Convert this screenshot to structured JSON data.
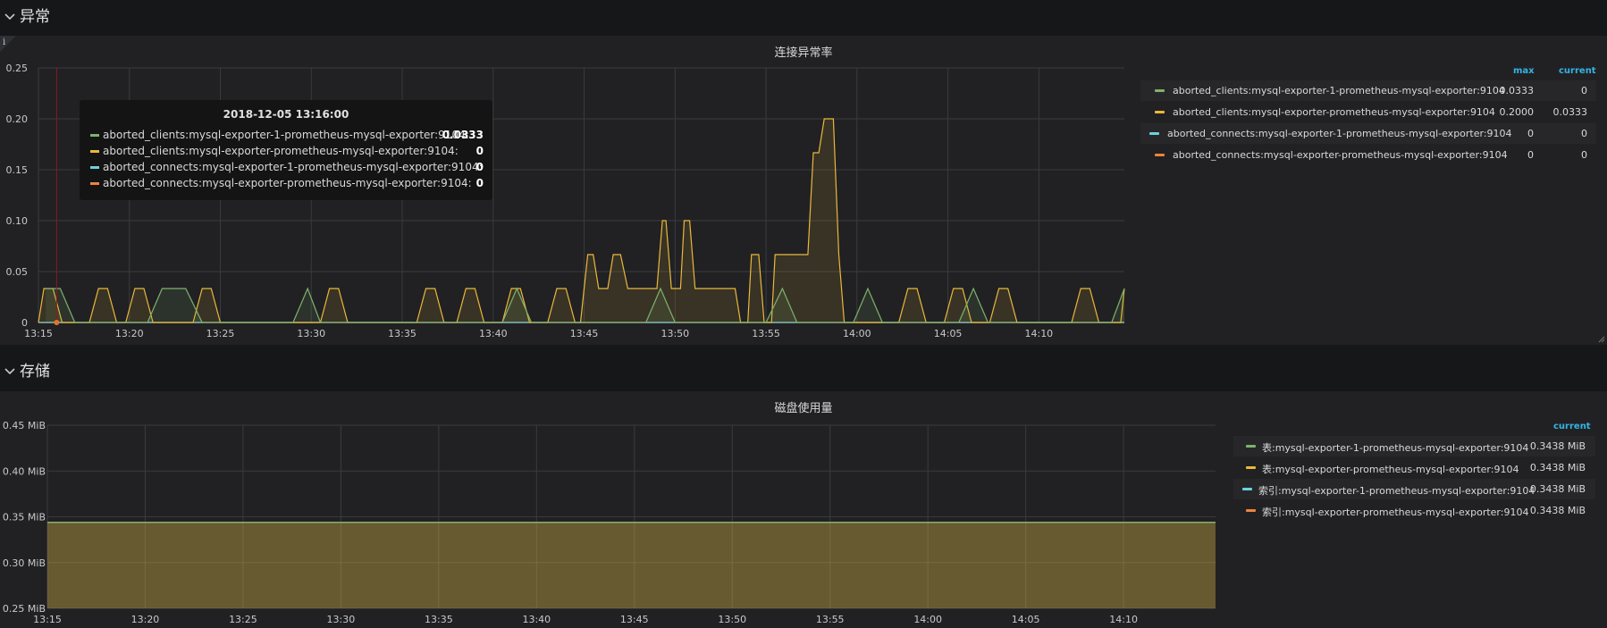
{
  "rows": [
    {
      "title": "异常"
    },
    {
      "title": "存储"
    }
  ],
  "anomaly_panel": {
    "title": "连接异常率",
    "legend_headers": {
      "max": "max",
      "current": "current"
    },
    "legend": [
      {
        "name": "aborted_clients:mysql-exporter-1-prometheus-mysql-exporter:9104",
        "max": "0.0333",
        "current": "0",
        "color": "#7eb26d"
      },
      {
        "name": "aborted_clients:mysql-exporter-prometheus-mysql-exporter:9104",
        "max": "0.2000",
        "current": "0.0333",
        "color": "#eab839"
      },
      {
        "name": "aborted_connects:mysql-exporter-1-prometheus-mysql-exporter:9104",
        "max": "0",
        "current": "0",
        "color": "#6ed0e0"
      },
      {
        "name": "aborted_connects:mysql-exporter-prometheus-mysql-exporter:9104",
        "max": "0",
        "current": "0",
        "color": "#ef843c"
      }
    ],
    "tooltip": {
      "time": "2018-12-05 13:16:00",
      "rows": [
        {
          "name": "aborted_clients:mysql-exporter-1-prometheus-mysql-exporter:9104:",
          "value": "0.0333",
          "color": "#7eb26d"
        },
        {
          "name": "aborted_clients:mysql-exporter-prometheus-mysql-exporter:9104:",
          "value": "0",
          "color": "#eab839"
        },
        {
          "name": "aborted_connects:mysql-exporter-1-prometheus-mysql-exporter:9104:",
          "value": "0",
          "color": "#6ed0e0"
        },
        {
          "name": "aborted_connects:mysql-exporter-prometheus-mysql-exporter:9104:",
          "value": "0",
          "color": "#ef843c"
        }
      ]
    }
  },
  "storage_panel": {
    "title": "磁盘使用量",
    "legend_headers": {
      "current": "current"
    },
    "legend": [
      {
        "name": "表:mysql-exporter-1-prometheus-mysql-exporter:9104",
        "current": "0.3438 MiB",
        "color": "#7eb26d"
      },
      {
        "name": "表:mysql-exporter-prometheus-mysql-exporter:9104",
        "current": "0.3438 MiB",
        "color": "#eab839"
      },
      {
        "name": "索引:mysql-exporter-1-prometheus-mysql-exporter:9104",
        "current": "0.3438 MiB",
        "color": "#6ed0e0"
      },
      {
        "name": "索引:mysql-exporter-prometheus-mysql-exporter:9104",
        "current": "0.3438 MiB",
        "color": "#ef843c"
      }
    ]
  },
  "chart_data": [
    {
      "type": "area",
      "title": "连接异常率",
      "x_tick_labels": [
        "13:15",
        "13:20",
        "13:25",
        "13:30",
        "13:35",
        "13:40",
        "13:45",
        "13:50",
        "13:55",
        "14:00",
        "14:05",
        "14:10"
      ],
      "x_range_minutes": [
        0,
        59.7
      ],
      "y_tick_labels": [
        "0",
        "0.05",
        "0.10",
        "0.15",
        "0.20",
        "0.25"
      ],
      "ylim": [
        0,
        0.25
      ],
      "grid": true,
      "legend_position": "right",
      "marker_time_minutes": 1,
      "series": [
        {
          "name": "aborted_clients:mysql-exporter-1-prometheus-mysql-exporter:9104",
          "color": "#7eb26d",
          "points": [
            [
              0.4,
              0.0333
            ],
            [
              1.2,
              0.0333
            ],
            [
              2,
              0
            ],
            [
              6,
              0
            ],
            [
              6.8,
              0.0333
            ],
            [
              8.1,
              0.0333
            ],
            [
              9,
              0
            ],
            [
              14,
              0
            ],
            [
              14.8,
              0.0333
            ],
            [
              15.5,
              0
            ],
            [
              25.5,
              0
            ],
            [
              26.3,
              0.0333
            ],
            [
              27.1,
              0
            ],
            [
              33.4,
              0
            ],
            [
              34.2,
              0.0333
            ],
            [
              35,
              0
            ],
            [
              40,
              0
            ],
            [
              40.9,
              0.0333
            ],
            [
              41.7,
              0
            ],
            [
              44.8,
              0
            ],
            [
              45.6,
              0.0333
            ],
            [
              46.4,
              0
            ],
            [
              50.6,
              0
            ],
            [
              51.4,
              0.0333
            ],
            [
              52.2,
              0
            ],
            [
              59,
              0
            ],
            [
              59.8,
              0.0333
            ],
            [
              60,
              0.0333
            ]
          ]
        },
        {
          "name": "aborted_clients:mysql-exporter-prometheus-mysql-exporter:9104",
          "color": "#eab839",
          "points": [
            [
              0,
              0
            ],
            [
              0.3,
              0.0333
            ],
            [
              0.8,
              0.0333
            ],
            [
              1.3,
              0
            ],
            [
              2.8,
              0
            ],
            [
              3.3,
              0.0333
            ],
            [
              3.8,
              0.0333
            ],
            [
              4.3,
              0
            ],
            [
              4.8,
              0
            ],
            [
              5.3,
              0.0333
            ],
            [
              5.8,
              0.0333
            ],
            [
              6.3,
              0
            ],
            [
              8.5,
              0
            ],
            [
              9,
              0.0333
            ],
            [
              9.5,
              0.0333
            ],
            [
              10,
              0
            ],
            [
              15.5,
              0
            ],
            [
              16,
              0.0333
            ],
            [
              16.5,
              0.0333
            ],
            [
              17,
              0
            ],
            [
              20.8,
              0
            ],
            [
              21.3,
              0.0333
            ],
            [
              21.8,
              0.0333
            ],
            [
              22.3,
              0
            ],
            [
              23,
              0
            ],
            [
              23.5,
              0.0333
            ],
            [
              24,
              0.0333
            ],
            [
              24.5,
              0
            ],
            [
              25.5,
              0
            ],
            [
              26,
              0.0333
            ],
            [
              26.5,
              0.0333
            ],
            [
              27,
              0
            ],
            [
              28,
              0
            ],
            [
              28.5,
              0.0333
            ],
            [
              29,
              0.0333
            ],
            [
              29.5,
              0
            ],
            [
              29.8,
              0
            ],
            [
              30.2,
              0.0667
            ],
            [
              30.5,
              0.0667
            ],
            [
              30.8,
              0.0333
            ],
            [
              31.3,
              0.0333
            ],
            [
              31.6,
              0.0667
            ],
            [
              32,
              0.0667
            ],
            [
              32.4,
              0.0333
            ],
            [
              34,
              0.0333
            ],
            [
              34.3,
              0.1
            ],
            [
              34.5,
              0.1
            ],
            [
              34.8,
              0.0333
            ],
            [
              35.3,
              0.0333
            ],
            [
              35.5,
              0.1
            ],
            [
              35.8,
              0.1
            ],
            [
              36.1,
              0.0333
            ],
            [
              38.3,
              0.0333
            ],
            [
              38.6,
              0
            ],
            [
              39,
              0
            ],
            [
              39.2,
              0.0667
            ],
            [
              39.6,
              0.0667
            ],
            [
              39.9,
              0
            ],
            [
              40.3,
              0
            ],
            [
              40.5,
              0.0667
            ],
            [
              41.5,
              0.0667
            ],
            [
              41.8,
              0.0667
            ],
            [
              42.3,
              0.0667
            ],
            [
              42.6,
              0.1667
            ],
            [
              42.9,
              0.1667
            ],
            [
              43.2,
              0.2
            ],
            [
              43.7,
              0.2
            ],
            [
              44,
              0.0667
            ],
            [
              44.3,
              0
            ],
            [
              47.3,
              0
            ],
            [
              47.8,
              0.0333
            ],
            [
              48.3,
              0.0333
            ],
            [
              48.8,
              0
            ],
            [
              49.8,
              0
            ],
            [
              50.3,
              0.0333
            ],
            [
              50.8,
              0.0333
            ],
            [
              51.3,
              0
            ],
            [
              52.3,
              0
            ],
            [
              52.8,
              0.0333
            ],
            [
              53.3,
              0.0333
            ],
            [
              53.8,
              0
            ],
            [
              56.8,
              0
            ],
            [
              57.3,
              0.0333
            ],
            [
              57.8,
              0.0333
            ],
            [
              58.3,
              0
            ],
            [
              59.5,
              0
            ],
            [
              59.8,
              0.0333
            ],
            [
              60,
              0.0333
            ]
          ]
        },
        {
          "name": "aborted_connects:mysql-exporter-1-prometheus-mysql-exporter:9104",
          "color": "#6ed0e0",
          "points": [
            [
              0,
              0
            ],
            [
              60,
              0
            ]
          ]
        },
        {
          "name": "aborted_connects:mysql-exporter-prometheus-mysql-exporter:9104",
          "color": "#ef843c",
          "points": [
            [
              0,
              0
            ],
            [
              60,
              0
            ]
          ]
        }
      ]
    },
    {
      "type": "area",
      "title": "磁盘使用量",
      "x_tick_labels": [
        "13:15",
        "13:20",
        "13:25",
        "13:30",
        "13:35",
        "13:40",
        "13:45",
        "13:50",
        "13:55",
        "14:00",
        "14:05",
        "14:10"
      ],
      "x_range_minutes": [
        0,
        59.7
      ],
      "y_tick_labels": [
        "0.25 MiB",
        "0.30 MiB",
        "0.35 MiB",
        "0.40 MiB",
        "0.45 MiB"
      ],
      "ylim": [
        0.25,
        0.45
      ],
      "grid": true,
      "legend_position": "right",
      "series": [
        {
          "name": "表:mysql-exporter-1-prometheus-mysql-exporter:9104",
          "color": "#7eb26d",
          "value": 0.3438
        },
        {
          "name": "表:mysql-exporter-prometheus-mysql-exporter:9104",
          "color": "#eab839",
          "value": 0.3438
        },
        {
          "name": "索引:mysql-exporter-1-prometheus-mysql-exporter:9104",
          "color": "#6ed0e0",
          "value": 0.3438
        },
        {
          "name": "索引:mysql-exporter-prometheus-mysql-exporter:9104",
          "color": "#ef843c",
          "value": 0.3438
        }
      ]
    }
  ]
}
